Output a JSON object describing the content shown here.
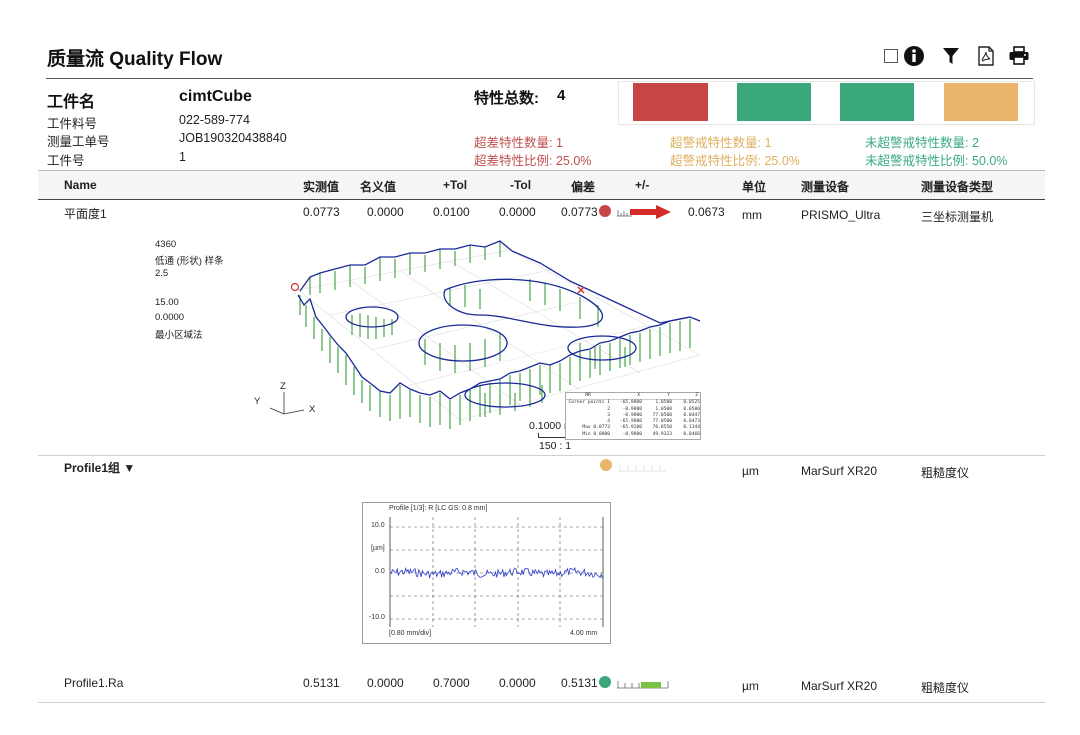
{
  "header": {
    "title": "质量流 Quality Flow",
    "icons": [
      "checkbox-icon",
      "info-icon",
      "filter-icon",
      "pdf-icon",
      "print-icon"
    ]
  },
  "part": {
    "name_label": "工件名",
    "name_value": "cimtCube",
    "number_label": "工件料号",
    "number_value": "022-589-774",
    "job_label": "测量工单号",
    "job_value": "JOB190320438840",
    "serial_label": "工件号",
    "serial_value": "1"
  },
  "summary": {
    "total_label": "特性总数:",
    "total_value": "4",
    "out_count": "超差特性数量: 1",
    "out_ratio": "超差特性比例: 25.0%",
    "warn_count": "超警戒特性数量: 1",
    "warn_ratio": "超警戒特性比例: 25.0%",
    "ok_count": "未超警戒特性数量: 2",
    "ok_ratio": "未超警戒特性比例: 50.0%",
    "colors": {
      "out": "#c84545",
      "ok": "#3aa87a",
      "warn": "#e8b56a"
    }
  },
  "columns": [
    "Name",
    "实测值",
    "名义值",
    "+Tol",
    "-Tol",
    "偏差",
    "+/-",
    "单位",
    "测量设备",
    "测量设备类型"
  ],
  "rows": [
    {
      "name": "平面度1",
      "actual": "0.0773",
      "nominal": "0.0000",
      "ptol": "0.0100",
      "ntol": "0.0000",
      "dev": "0.0773",
      "pm": "0.0673",
      "unit": "mm",
      "device": "PRISMO_Ultra",
      "device_type": "三坐标测量机",
      "status_color": "#c84545"
    },
    {
      "name": "Profile1组 ▼",
      "unit": "µm",
      "device": "MarSurf XR20",
      "device_type": "粗糙度仪",
      "status_color": "#e8b56a"
    },
    {
      "name": "Profile1.Ra",
      "actual": "0.5131",
      "nominal": "0.0000",
      "ptol": "0.7000",
      "ntol": "0.0000",
      "dev": "0.5131",
      "unit": "µm",
      "device": "MarSurf XR20",
      "device_type": "粗糙度仪",
      "status_color": "#3aa87a"
    }
  ],
  "flatness_meta": [
    "4360",
    "低通 (形状) 样条",
    "2.5",
    "15.00",
    "0.0000",
    "最小区域法"
  ],
  "plot3d": {
    "axis_x": "X",
    "axis_y": "Y",
    "axis_z": "Z",
    "scale_label": "0.1000 mm",
    "ratio_label": "150 : 1",
    "table_header": [
      "NR",
      "X",
      "Y",
      "Z"
    ],
    "table_rows": [
      [
        "Corner points 1",
        "-65.9800",
        "1.0500",
        "0.0525"
      ],
      [
        "2",
        "-0.9800",
        "1.0500",
        "0.0500"
      ],
      [
        "3",
        "-0.9800",
        "77.0500",
        "0.0447"
      ],
      [
        "4",
        "-65.9800",
        "77.0500",
        "0.0473"
      ],
      [
        "Max 0.0773",
        "-65.9200",
        "76.8550",
        "0.1344"
      ],
      [
        "Min 0.0000",
        "-0.9800",
        "49.9323",
        "0.0466"
      ]
    ]
  },
  "profile_chart": {
    "title": "Profile [1/3]: R [LC GS: 0.8 mm]",
    "unit": "[µm]",
    "yticks": [
      "10.0",
      "0.0",
      "-10.0"
    ],
    "x_left": "[0.80 mm/div]",
    "x_right": "4.00 mm"
  }
}
